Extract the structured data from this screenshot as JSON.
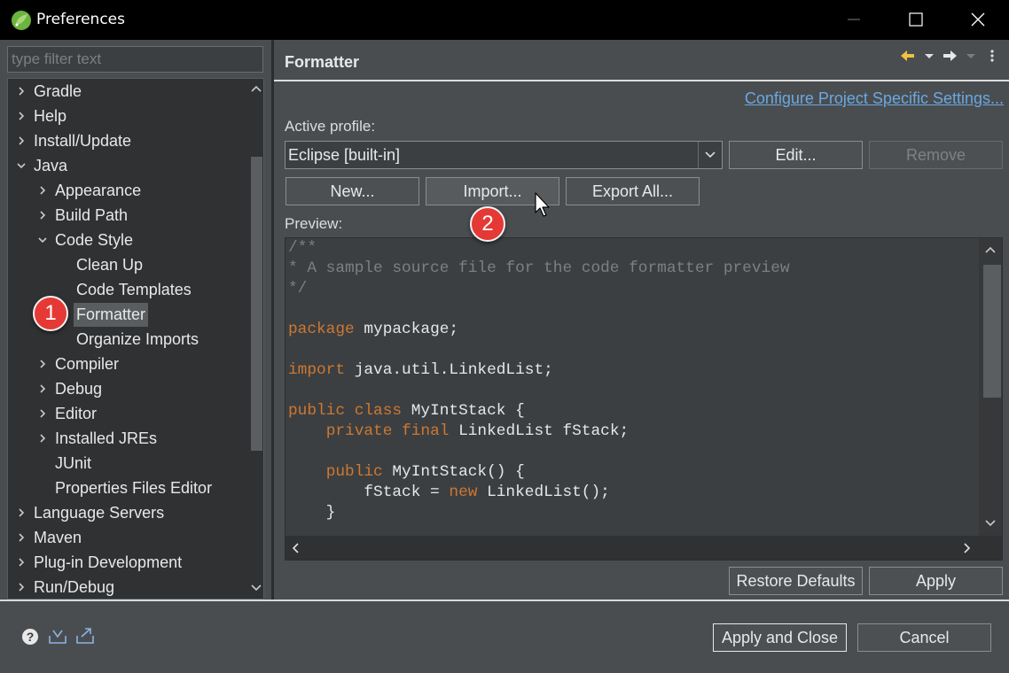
{
  "window": {
    "title": "Preferences",
    "controls": [
      "minimize",
      "maximize",
      "close"
    ]
  },
  "filter": {
    "placeholder": "type filter text",
    "value": ""
  },
  "tree": {
    "items": [
      {
        "label": "Gradle",
        "expander": "collapsed"
      },
      {
        "label": "Help",
        "expander": "collapsed"
      },
      {
        "label": "Install/Update",
        "expander": "collapsed"
      },
      {
        "label": "Java",
        "expander": "expanded"
      },
      {
        "label": "Appearance",
        "expander": "collapsed"
      },
      {
        "label": "Build Path",
        "expander": "collapsed"
      },
      {
        "label": "Code Style",
        "expander": "expanded"
      },
      {
        "label": "Clean Up",
        "expander": "none"
      },
      {
        "label": "Code Templates",
        "expander": "none"
      },
      {
        "label": "Formatter",
        "expander": "none",
        "selected": true
      },
      {
        "label": "Organize Imports",
        "expander": "none"
      },
      {
        "label": "Compiler",
        "expander": "collapsed"
      },
      {
        "label": "Debug",
        "expander": "collapsed"
      },
      {
        "label": "Editor",
        "expander": "collapsed"
      },
      {
        "label": "Installed JREs",
        "expander": "collapsed"
      },
      {
        "label": "JUnit",
        "expander": "none"
      },
      {
        "label": "Properties Files Editor",
        "expander": "none"
      },
      {
        "label": "Language Servers",
        "expander": "collapsed"
      },
      {
        "label": "Maven",
        "expander": "collapsed"
      },
      {
        "label": "Plug-in Development",
        "expander": "collapsed"
      },
      {
        "label": "Run/Debug",
        "expander": "collapsed"
      }
    ]
  },
  "page": {
    "title": "Formatter",
    "configure_link": "Configure Project Specific Settings...",
    "active_profile_label": "Active profile:",
    "active_profile_value": "Eclipse [built-in]",
    "buttons": {
      "edit": "Edit...",
      "remove": "Remove",
      "new": "New...",
      "import": "Import...",
      "export_all": "Export All..."
    },
    "preview_label": "Preview:",
    "preview_code": [
      [
        {
          "t": "/**",
          "c": "cm"
        }
      ],
      [
        {
          "t": "* A sample source file for the code formatter preview",
          "c": "cm"
        }
      ],
      [
        {
          "t": "*/",
          "c": "cm"
        }
      ],
      [],
      [
        {
          "t": "package",
          "c": "kw"
        },
        {
          "t": " mypackage;"
        }
      ],
      [],
      [
        {
          "t": "import",
          "c": "kw"
        },
        {
          "t": " java.util.LinkedList;"
        }
      ],
      [],
      [
        {
          "t": "public",
          "c": "kw"
        },
        {
          "t": " "
        },
        {
          "t": "class",
          "c": "kw"
        },
        {
          "t": " MyIntStack {"
        }
      ],
      [
        {
          "t": "    "
        },
        {
          "t": "private",
          "c": "kw"
        },
        {
          "t": " "
        },
        {
          "t": "final",
          "c": "kw"
        },
        {
          "t": " LinkedList fStack;"
        }
      ],
      [],
      [
        {
          "t": "    "
        },
        {
          "t": "public",
          "c": "kw"
        },
        {
          "t": " MyIntStack() {"
        }
      ],
      [
        {
          "t": "        fStack = "
        },
        {
          "t": "new",
          "c": "kw"
        },
        {
          "t": " LinkedList();"
        }
      ],
      [
        {
          "t": "    }"
        }
      ]
    ],
    "restore_defaults": "Restore Defaults",
    "apply": "Apply"
  },
  "footer": {
    "apply_and_close": "Apply and Close",
    "cancel": "Cancel",
    "icons": [
      "help-icon",
      "import-preferences-icon",
      "export-preferences-icon"
    ]
  },
  "callouts": {
    "one": "1",
    "two": "2"
  },
  "colors": {
    "keyword": "#cc7832",
    "comment": "#7d7f82",
    "link": "#6aa8e0",
    "callout": "#e53935"
  }
}
